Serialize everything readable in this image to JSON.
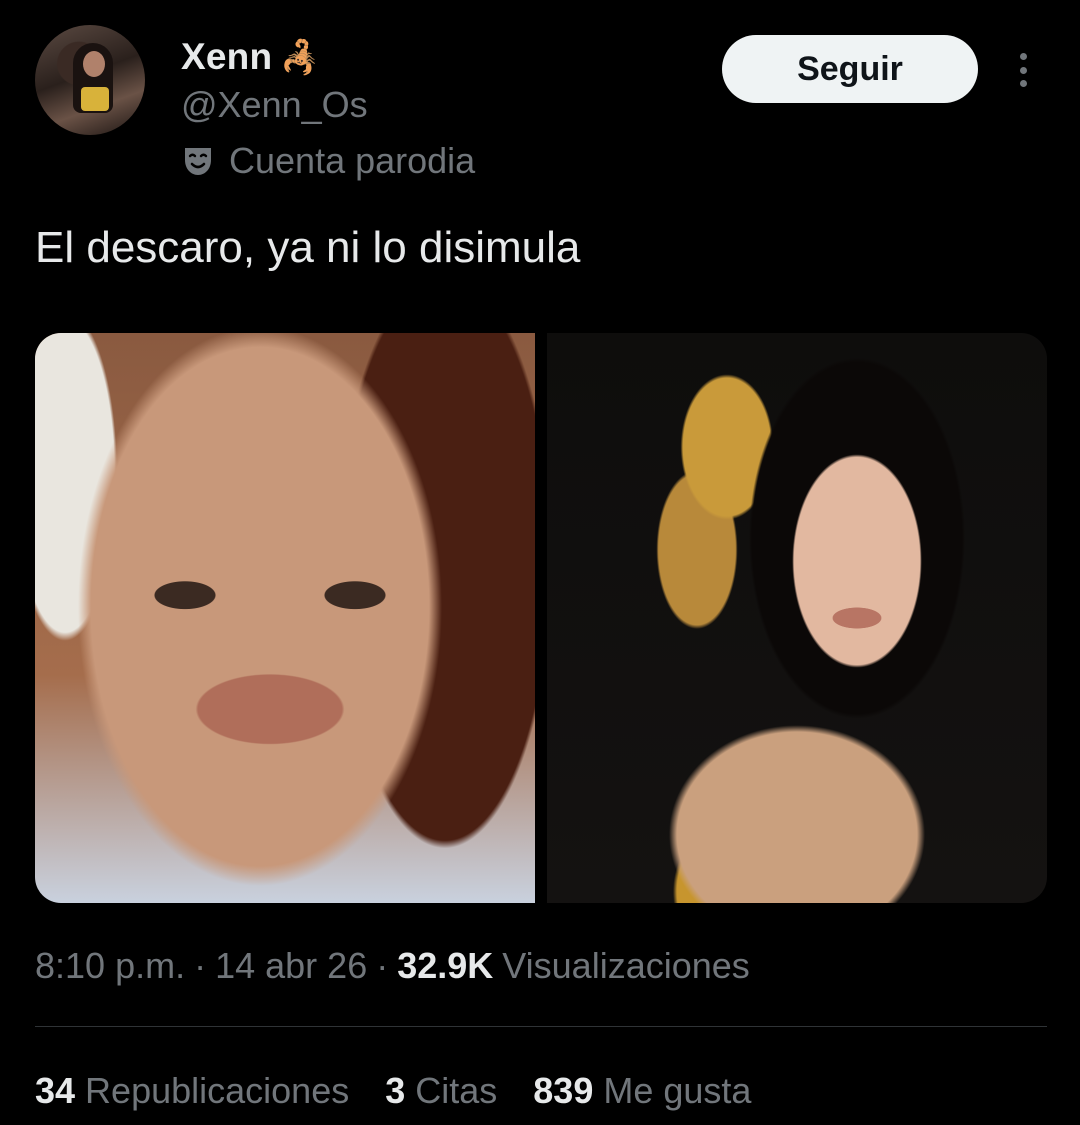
{
  "author": {
    "name": "Xenn",
    "emoji": "🦂",
    "handle": "@Xenn_Os",
    "label": "Cuenta parodia"
  },
  "actions": {
    "follow_label": "Seguir"
  },
  "tweet": {
    "text": "El descaro, ya ni lo disimula"
  },
  "meta": {
    "time": "8:10 p.m.",
    "sep": "·",
    "date": "14 abr 26",
    "views_count": "32.9K",
    "views_label": "Visualizaciones"
  },
  "stats": {
    "reposts_count": "34",
    "reposts_label": "Republicaciones",
    "quotes_count": "3",
    "quotes_label": "Citas",
    "likes_count": "839",
    "likes_label": "Me gusta"
  },
  "icons": {
    "parody": "theater-mask-icon",
    "more": "more-vertical-icon"
  },
  "colors": {
    "background": "#000000",
    "primary_text": "#e7e9ea",
    "secondary_text": "#71767b",
    "button_bg": "#eff3f4",
    "divider": "#2f3336"
  }
}
